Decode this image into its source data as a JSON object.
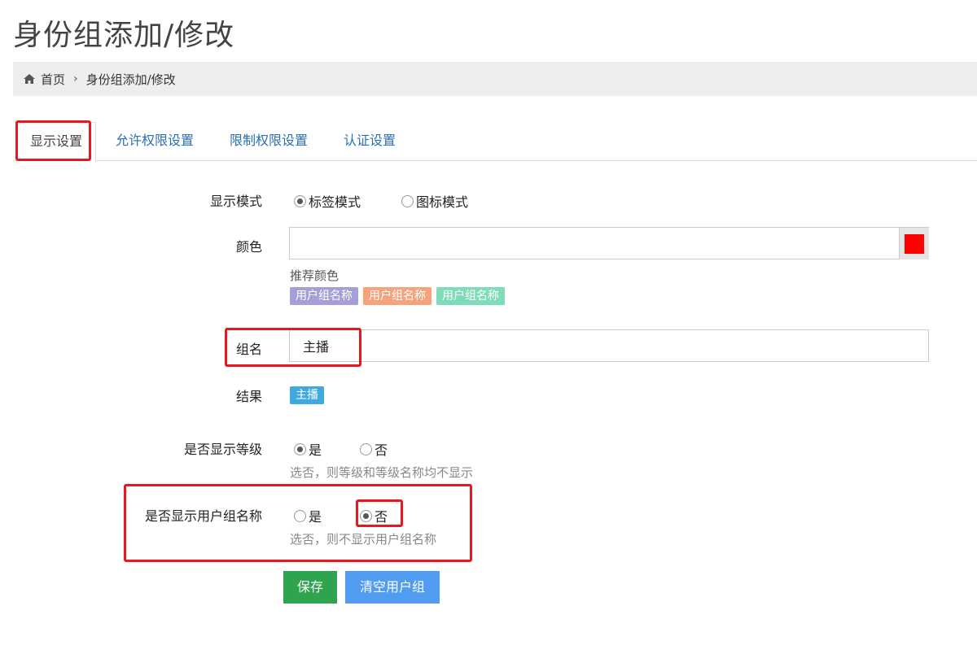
{
  "page": {
    "title": "身份组添加/修改"
  },
  "breadcrumb": {
    "home": "首页",
    "separator": "›",
    "current": "身份组添加/修改"
  },
  "tabs": [
    {
      "label": "显示设置",
      "active": true
    },
    {
      "label": "允许权限设置",
      "active": false
    },
    {
      "label": "限制权限设置",
      "active": false
    },
    {
      "label": "认证设置",
      "active": false
    }
  ],
  "form": {
    "display_mode": {
      "label": "显示模式",
      "options": [
        {
          "label": "标签模式",
          "checked": true
        },
        {
          "label": "图标模式",
          "checked": false
        }
      ]
    },
    "color": {
      "label": "颜色",
      "value": "",
      "swatch": "#ff0000",
      "recommend_label": "推荐颜色",
      "chips": [
        {
          "label": "用户组名称",
          "color": "#a49ed9"
        },
        {
          "label": "用户组名称",
          "color": "#f7a27b"
        },
        {
          "label": "用户组名称",
          "color": "#7fdcb8"
        }
      ]
    },
    "group_name": {
      "label": "组名",
      "value": "主播"
    },
    "result": {
      "label": "结果",
      "badge": "主播",
      "badge_color": "#3fa9dd"
    },
    "show_level": {
      "label": "是否显示等级",
      "options": [
        {
          "label": "是",
          "checked": true
        },
        {
          "label": "否",
          "checked": false
        }
      ],
      "help": "选否，则等级和等级名称均不显示"
    },
    "show_group_name": {
      "label": "是否显示用户组名称",
      "options": [
        {
          "label": "是",
          "checked": false
        },
        {
          "label": "否",
          "checked": true
        }
      ],
      "help": "选否，则不显示用户组名称"
    }
  },
  "buttons": {
    "save": "保存",
    "clear": "清空用户组"
  },
  "colors": {
    "save": "#2ea44f",
    "clear": "#4f9cf0",
    "highlight": "#e8161f",
    "link": "#2a6fb3"
  }
}
